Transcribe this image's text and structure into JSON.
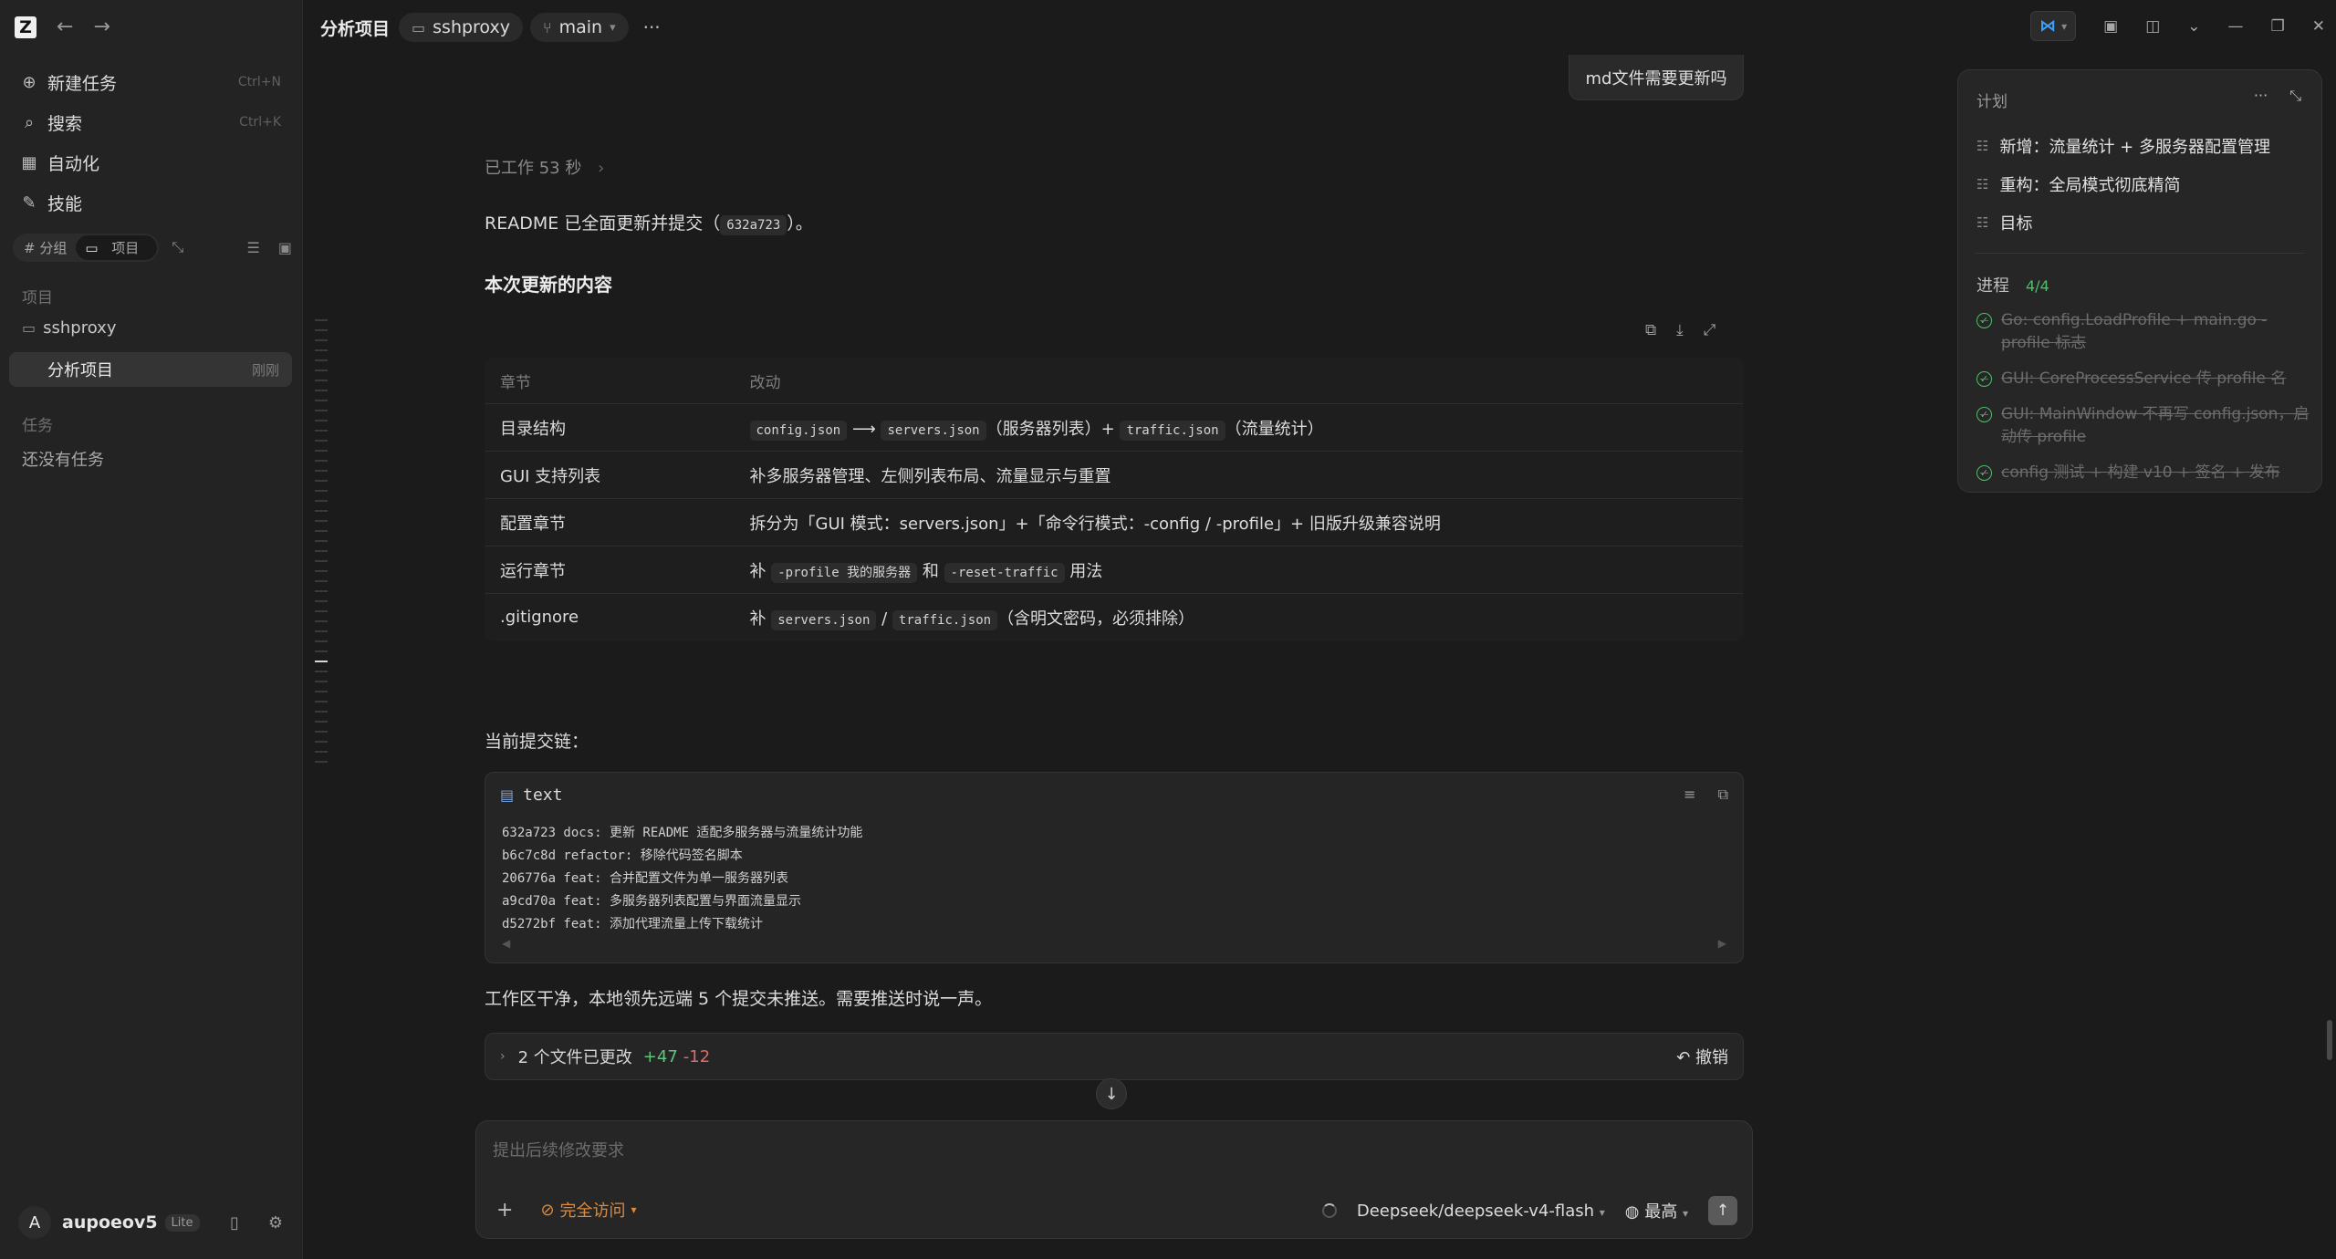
{
  "sidebar": {
    "menu": [
      {
        "label": "新建任务",
        "shortcut": "Ctrl+N",
        "icon": "plus-circle-icon"
      },
      {
        "label": "搜索",
        "shortcut": "Ctrl+K",
        "icon": "search-icon"
      },
      {
        "label": "自动化",
        "shortcut": "",
        "icon": "calendar-icon"
      },
      {
        "label": "技能",
        "shortcut": "",
        "icon": "wand-icon"
      }
    ],
    "toggle": {
      "group": "# 分组",
      "project": "项目"
    },
    "projects_label": "项目",
    "projects": [
      {
        "label": "sshproxy",
        "badge": ""
      },
      {
        "label": "分析项目",
        "badge": "刚刚"
      }
    ],
    "tasks_label": "任务",
    "tasks_empty": "还没有任务",
    "user": {
      "initial": "A",
      "name": "aupoeov5",
      "plan": "Lite"
    }
  },
  "topbar": {
    "title": "分析项目",
    "folder": "sshproxy",
    "branch": "main",
    "more": "···"
  },
  "conversation": {
    "user_message": "md文件需要更新吗",
    "worked": "已工作 53 秒",
    "readme_prefix": "README 已全面更新并提交（",
    "readme_commit": "632a723",
    "readme_suffix": "）。",
    "section_title": "本次更新的内容",
    "table": {
      "headers": [
        "章节",
        "改动"
      ],
      "rows": [
        {
          "section": "目录结构",
          "parts": [
            {
              "c": "config.json"
            },
            {
              "t": " ⟶ "
            },
            {
              "c": "servers.json"
            },
            {
              "t": "（服务器列表）+ "
            },
            {
              "c": "traffic.json"
            },
            {
              "t": "（流量统计）"
            }
          ]
        },
        {
          "section": "GUI 支持列表",
          "parts": [
            {
              "t": "补多服务器管理、左侧列表布局、流量显示与重置"
            }
          ]
        },
        {
          "section": "配置章节",
          "parts": [
            {
              "t": "拆分为「GUI 模式：servers.json」+「命令行模式：-config / -profile」+ 旧版升级兼容说明"
            }
          ]
        },
        {
          "section": "运行章节",
          "parts": [
            {
              "t": "补 "
            },
            {
              "c": "-profile 我的服务器"
            },
            {
              "t": " 和 "
            },
            {
              "c": "-reset-traffic"
            },
            {
              "t": " 用法"
            }
          ]
        },
        {
          "section": ".gitignore",
          "parts": [
            {
              "t": "补 "
            },
            {
              "c": "servers.json"
            },
            {
              "t": " / "
            },
            {
              "c": "traffic.json"
            },
            {
              "t": "（含明文密码，必须排除）"
            }
          ]
        }
      ]
    },
    "chain_label": "当前提交链：",
    "code": {
      "lang": "text",
      "lines": [
        "632a723 docs: 更新 README 适配多服务器与流量统计功能",
        "b6c7c8d refactor: 移除代码签名脚本",
        "206776a feat: 合并配置文件为单一服务器列表",
        "a9cd70a feat: 多服务器列表配置与界面流量显示",
        "d5272bf feat: 添加代理流量上传下载统计"
      ]
    },
    "summary": "工作区干净，本地领先远端 5 个提交未推送。需要推送时说一声。",
    "files": {
      "label": "2 个文件已更改",
      "added": "+47",
      "removed": "-12",
      "undo": "撤销"
    }
  },
  "composer": {
    "placeholder": "提出后续修改要求",
    "access": "完全访问",
    "model": "Deepseek/deepseek-v4-flash",
    "effort": "最高"
  },
  "plan": {
    "title": "计划",
    "items": [
      "新增：流量统计 + 多服务器配置管理",
      "重构：全局模式彻底精简",
      "目标"
    ],
    "progress_label": "进程",
    "progress_count": "4/4",
    "steps": [
      "Go: config.LoadProfile + main.go -profile 标志",
      "GUI: CoreProcessService 传 profile 名",
      "GUI: MainWindow 不再写 config.json，启动传 profile",
      "config 测试 + 构建 v10 + 签名 + 发布"
    ]
  },
  "colors": {
    "accent_access": "#e08a3a",
    "progress_ok": "#4fbf6a",
    "diff_add": "#5fc77a",
    "diff_remove": "#e06a6a"
  }
}
